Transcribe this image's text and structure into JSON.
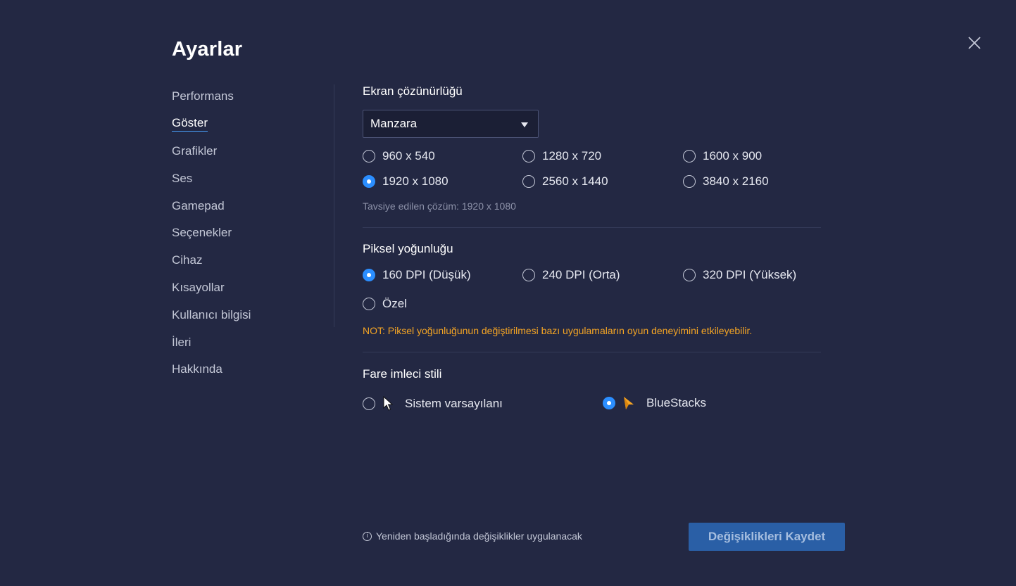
{
  "header": {
    "title": "Ayarlar"
  },
  "sidebar": {
    "items": [
      {
        "label": "Performans"
      },
      {
        "label": "Göster"
      },
      {
        "label": "Grafikler"
      },
      {
        "label": "Ses"
      },
      {
        "label": "Gamepad"
      },
      {
        "label": "Seçenekler"
      },
      {
        "label": "Cihaz"
      },
      {
        "label": "Kısayollar"
      },
      {
        "label": "Kullanıcı bilgisi"
      },
      {
        "label": "İleri"
      },
      {
        "label": "Hakkında"
      }
    ],
    "active_index": 1
  },
  "resolution": {
    "title": "Ekran çözünürlüğü",
    "orientation_value": "Manzara",
    "options": [
      {
        "label": "960 x 540",
        "checked": false
      },
      {
        "label": "1280 x 720",
        "checked": false
      },
      {
        "label": "1600 x 900",
        "checked": false
      },
      {
        "label": "1920 x 1080",
        "checked": true
      },
      {
        "label": "2560 x 1440",
        "checked": false
      },
      {
        "label": "3840 x 2160",
        "checked": false
      }
    ],
    "recommended": "Tavsiye edilen çözüm: 1920 x 1080"
  },
  "density": {
    "title": "Piksel yoğunluğu",
    "options": [
      {
        "label": "160 DPI (Düşük)",
        "checked": true
      },
      {
        "label": "240 DPI (Orta)",
        "checked": false
      },
      {
        "label": "320 DPI (Yüksek)",
        "checked": false
      },
      {
        "label": "Özel",
        "checked": false
      }
    ],
    "note": "NOT: Piksel yoğunluğunun değiştirilmesi bazı uygulamaların oyun deneyimini etkileyebilir."
  },
  "cursor": {
    "title": "Fare imleci stili",
    "options": [
      {
        "label": "Sistem varsayılanı",
        "checked": false,
        "icon": "white-arrow-cursor-icon"
      },
      {
        "label": "BlueStacks",
        "checked": true,
        "icon": "orange-arrow-cursor-icon"
      }
    ]
  },
  "footer": {
    "info_text": "Yeniden başladığında değişiklikler uygulanacak",
    "save_label": "Değişiklikleri Kaydet"
  },
  "colors": {
    "background": "#232843",
    "accent": "#2b8eff",
    "warning": "#f5a524",
    "save_button": "#2a5fa6"
  }
}
